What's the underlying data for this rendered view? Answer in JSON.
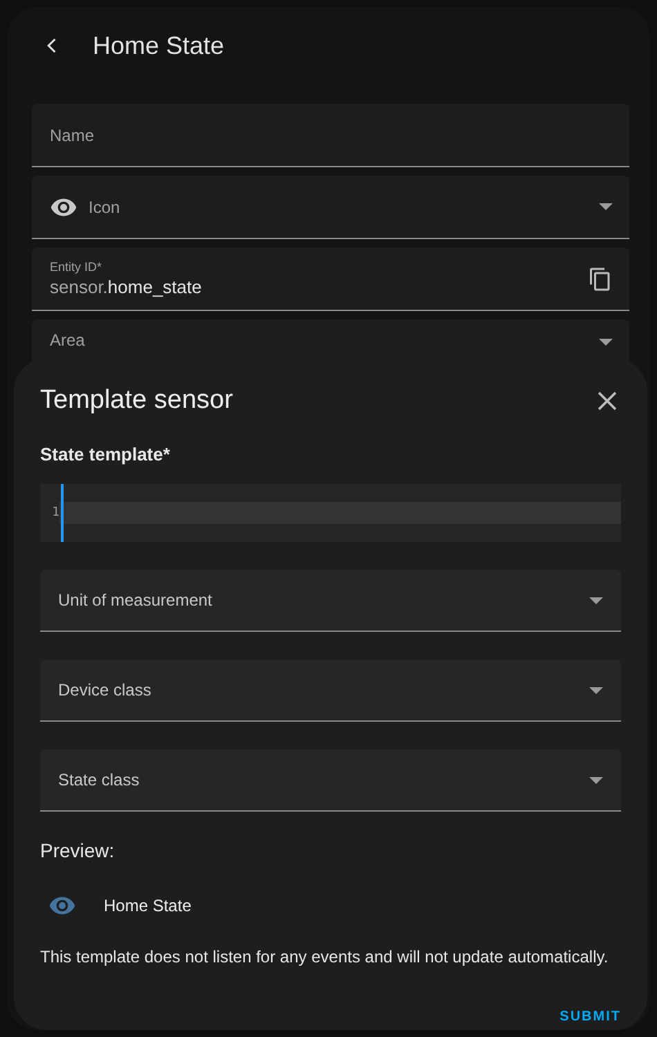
{
  "header": {
    "title": "Home State"
  },
  "fields": [
    {
      "kind": "text",
      "label": "Name"
    },
    {
      "kind": "icon-select",
      "label": "Icon"
    },
    {
      "kind": "copy",
      "label": "Entity ID*",
      "value": "sensor.**home_state**"
    },
    {
      "kind": "select",
      "label": "Area"
    }
  ],
  "dialog": {
    "title": "Template sensor",
    "editor": {
      "label": "State template*",
      "line_numbers": [
        "1"
      ]
    },
    "selects": [
      {
        "label": "Unit of measurement"
      },
      {
        "label": "Device class"
      },
      {
        "label": "State class"
      }
    ],
    "preview": {
      "heading": "Preview:",
      "entity_name": "Home State",
      "message": "This template does not listen for any events and will not update automatically."
    },
    "buttons": [
      "SUBMIT"
    ]
  }
}
